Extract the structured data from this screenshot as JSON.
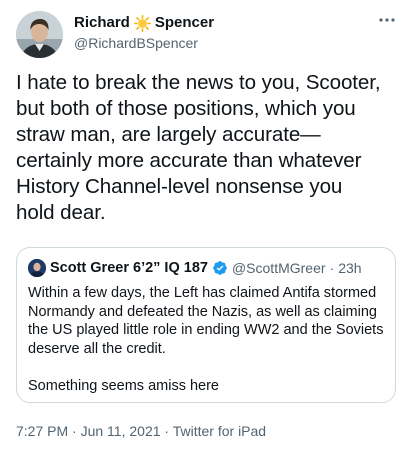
{
  "author": {
    "name_first": "Richard",
    "name_last": "Spencer",
    "name_emoji": "sun-emoji",
    "handle": "@RichardBSpencer"
  },
  "tweet": {
    "text": "I hate to break the news to you, Scooter,\nbut both of those positions, which you\nstraw man, are largely accurate—\ncertainly more accurate than whatever\nHistory Channel-level nonsense you\nhold dear."
  },
  "quote": {
    "name": "Scott Greer 6’2” IQ 187",
    "verified_badge": "verified-badge-icon",
    "handle": "@ScottMGreer",
    "separator": "·",
    "time": "23h",
    "paragraphs": [
      "Within a few days, the Left has claimed Antifa stormed Normandy and defeated the Nazis, as well as claiming the US played little role in ending WW2 and the Soviets deserve all the credit.",
      "Something seems amiss here"
    ]
  },
  "footer": {
    "time": "7:27 PM",
    "date": "Jun 11, 2021",
    "source": "Twitter for iPad",
    "separator": "·"
  },
  "colors": {
    "text": "#0f1419",
    "secondary": "#536471",
    "border": "#cfd9de",
    "verified": "#1d9bf0"
  }
}
